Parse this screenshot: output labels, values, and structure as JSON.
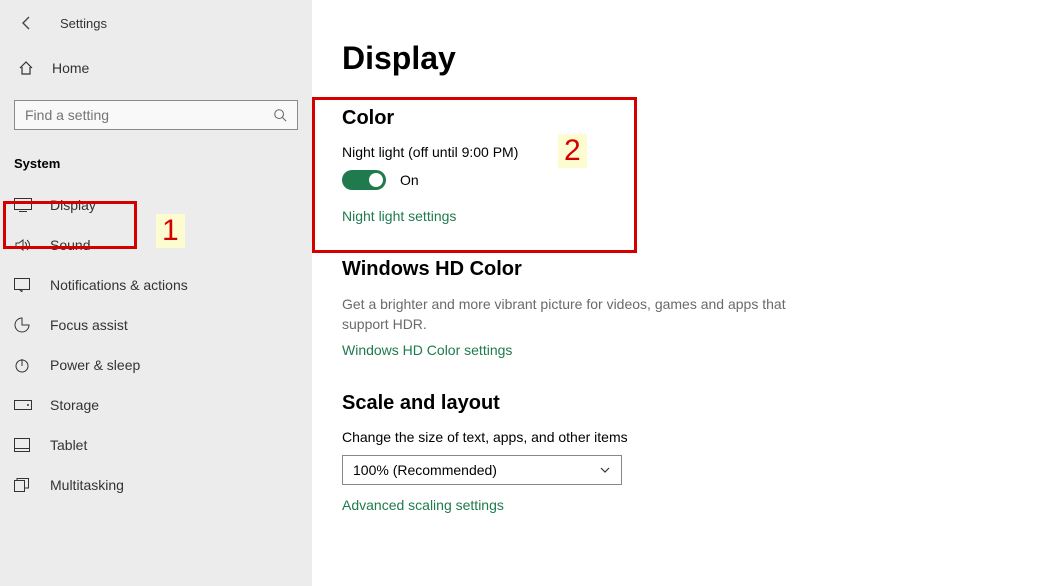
{
  "header": {
    "title": "Settings"
  },
  "sidebar": {
    "home_label": "Home",
    "search_placeholder": "Find a setting",
    "group_label": "System",
    "items": [
      {
        "label": "Display"
      },
      {
        "label": "Sound"
      },
      {
        "label": "Notifications & actions"
      },
      {
        "label": "Focus assist"
      },
      {
        "label": "Power & sleep"
      },
      {
        "label": "Storage"
      },
      {
        "label": "Tablet"
      },
      {
        "label": "Multitasking"
      }
    ]
  },
  "main": {
    "page_title": "Display",
    "color": {
      "section_title": "Color",
      "night_light_label": "Night light (off until 9:00 PM)",
      "toggle_state": "On",
      "settings_link": "Night light settings"
    },
    "hdcolor": {
      "section_title": "Windows HD Color",
      "description": "Get a brighter and more vibrant picture for videos, games and apps that support HDR.",
      "settings_link": "Windows HD Color settings"
    },
    "scale": {
      "section_title": "Scale and layout",
      "size_label": "Change the size of text, apps, and other items",
      "size_value": "100% (Recommended)",
      "advanced_link": "Advanced scaling settings"
    }
  },
  "annotations": {
    "n1": "1",
    "n2": "2"
  }
}
